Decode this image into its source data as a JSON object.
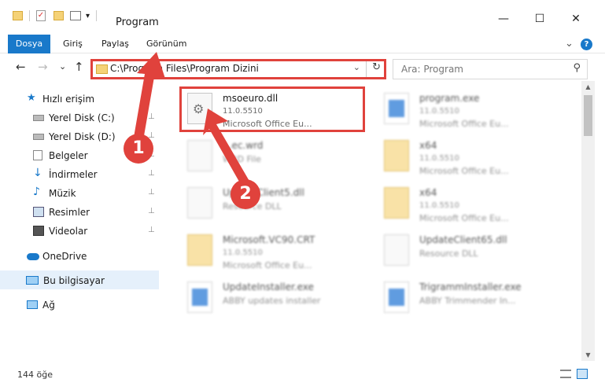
{
  "window": {
    "title": "Program",
    "controls": {
      "minimize": "—",
      "maximize": "☐",
      "close": "✕"
    }
  },
  "ribbon": {
    "tabs": [
      "Dosya",
      "Giriş",
      "Paylaş",
      "Görünüm"
    ],
    "expand": "⌄",
    "help": "?"
  },
  "nav": {
    "back": "←",
    "forward": "→",
    "recent": "⌄",
    "up": "↑"
  },
  "address": {
    "path": "C:\\Program Files\\Program Dizini",
    "dropdown": "⌄",
    "refresh": "↻"
  },
  "search": {
    "placeholder": "Ara: Program",
    "icon": "⚲"
  },
  "sidebar": {
    "items": [
      {
        "label": "Hızlı erişim",
        "icon": "star-icon"
      },
      {
        "label": "Yerel Disk (C:)",
        "icon": "drive-icon"
      },
      {
        "label": "Yerel Disk (D:)",
        "icon": "drive-icon"
      },
      {
        "label": "Belgeler",
        "icon": "document-icon"
      },
      {
        "label": "İndirmeler",
        "icon": "download-icon"
      },
      {
        "label": "Müzik",
        "icon": "music-icon"
      },
      {
        "label": "Resimler",
        "icon": "pictures-icon"
      },
      {
        "label": "Videolar",
        "icon": "video-icon"
      },
      {
        "label": "OneDrive",
        "icon": "cloud-icon"
      },
      {
        "label": "Bu bilgisayar",
        "icon": "computer-icon"
      },
      {
        "label": "Ağ",
        "icon": "network-icon"
      }
    ],
    "pin": "📌"
  },
  "files": {
    "highlighted": {
      "name": "msoeuro.dll",
      "version": "11.0.5510",
      "description": "Microsoft Office Eu..."
    },
    "items": [
      {
        "name": "program.exe",
        "version": "11.0.5510",
        "description": "Microsoft Office Eu..."
      },
      {
        "name": "...ec.wrd",
        "version": "",
        "description": "WRD File"
      },
      {
        "name": "x64",
        "version": "11.0.5510",
        "description": "Microsoft Office Eu..."
      },
      {
        "name": "UpdateClient5.dll",
        "version": "",
        "description": "Resource DLL"
      },
      {
        "name": "x64",
        "version": "11.0.5510",
        "description": "Microsoft Office Eu..."
      },
      {
        "name": "Microsoft.VC90.CRT",
        "version": "11.0.5510",
        "description": "Microsoft Office Eu..."
      },
      {
        "name": "UpdateClient65.dll",
        "version": "",
        "description": "Resource DLL"
      },
      {
        "name": "UpdateInstaller.exe",
        "version": "",
        "description": "ABBY updates installer"
      },
      {
        "name": "TrigrammInstaller.exe",
        "version": "",
        "description": "ABBY Trimmender In..."
      }
    ]
  },
  "annotations": {
    "step1": "1",
    "step2": "2",
    "color": "#e0423c"
  },
  "status": {
    "count": "144 öğe"
  },
  "colors": {
    "accent": "#1979ca",
    "highlight": "#e0423c"
  }
}
